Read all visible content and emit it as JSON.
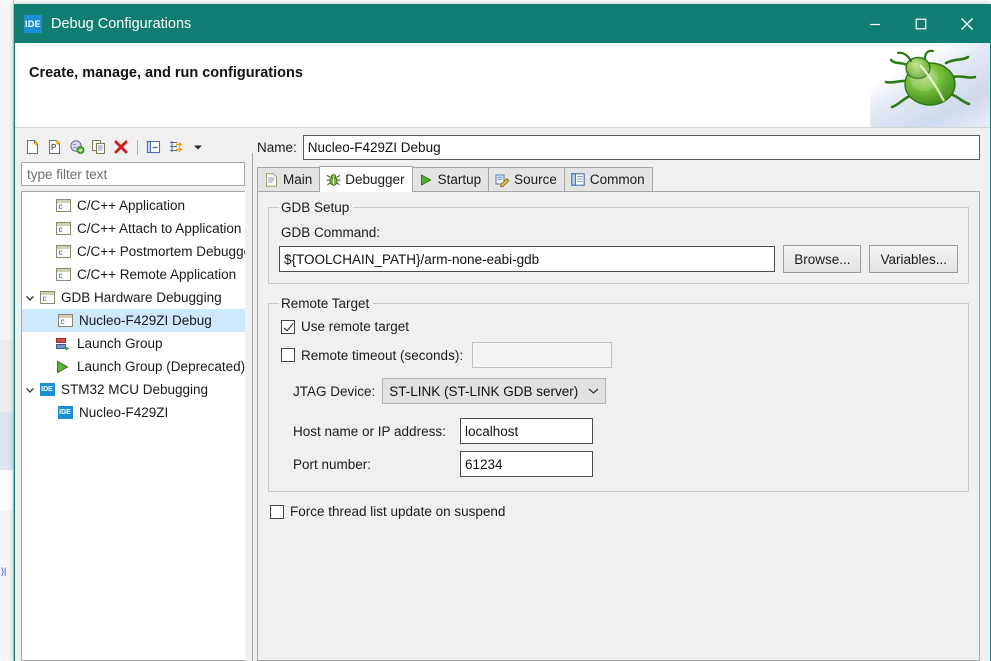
{
  "window": {
    "title": "Debug Configurations",
    "app_icon_text": "IDE",
    "minimize_label": "Minimize",
    "maximize_label": "Maximize",
    "close_label": "Close",
    "titlebar_color": "#117c71"
  },
  "banner": {
    "heading": "Create, manage, and run configurations",
    "art_icon": "green-bug"
  },
  "left_panel": {
    "toolbar": [
      {
        "name": "new-launch-configuration-icon",
        "label": "New launch configuration"
      },
      {
        "name": "new-prototype-icon",
        "label": "New prototype"
      },
      {
        "name": "export-launch-configuration-icon",
        "label": "Export"
      },
      {
        "name": "duplicate-icon",
        "label": "Duplicate"
      },
      {
        "name": "delete-icon",
        "label": "Delete"
      },
      {
        "name": "collapse-all-icon",
        "label": "Collapse All"
      },
      {
        "name": "filter-launch-configurations-icon",
        "label": "Filter launch configurations"
      },
      {
        "name": "view-menu-chevron-icon",
        "label": "View Menu"
      }
    ],
    "filter_placeholder": "type filter text",
    "filter_value": "",
    "tree": [
      {
        "label": "C/C++ Application",
        "indent": 1,
        "icon": "c-config-icon",
        "twisty": "none",
        "selected": false
      },
      {
        "label": "C/C++ Attach to Application",
        "indent": 1,
        "icon": "c-config-icon",
        "twisty": "none",
        "selected": false
      },
      {
        "label": "C/C++ Postmortem Debugger",
        "indent": 1,
        "icon": "c-config-icon",
        "twisty": "none",
        "selected": false
      },
      {
        "label": "C/C++ Remote Application",
        "indent": 1,
        "icon": "c-config-icon",
        "twisty": "none",
        "selected": false
      },
      {
        "label": "GDB Hardware Debugging",
        "indent": 1,
        "icon": "c-config-icon",
        "twisty": "expanded",
        "selected": false
      },
      {
        "label": "Nucleo-F429ZI Debug",
        "indent": 2,
        "icon": "c-config-icon",
        "twisty": "none",
        "selected": true
      },
      {
        "label": "Launch Group",
        "indent": 1,
        "icon": "launch-group-icon",
        "twisty": "none",
        "selected": false
      },
      {
        "label": "Launch Group (Deprecated)",
        "indent": 1,
        "icon": "launch-group-deprecated-icon",
        "twisty": "none",
        "selected": false
      },
      {
        "label": "STM32 MCU Debugging",
        "indent": 1,
        "icon": "ide-icon",
        "twisty": "expanded",
        "selected": false
      },
      {
        "label": "Nucleo-F429ZI",
        "indent": 2,
        "icon": "ide-icon",
        "twisty": "none",
        "selected": false
      }
    ]
  },
  "right_panel": {
    "name_label": "Name:",
    "name_value": "Nucleo-F429ZI Debug",
    "tabs": [
      {
        "label": "Main",
        "icon": "document-icon",
        "active": false
      },
      {
        "label": "Debugger",
        "icon": "bug-icon",
        "active": true
      },
      {
        "label": "Startup",
        "icon": "play-icon",
        "active": false
      },
      {
        "label": "Source",
        "icon": "source-folder-icon",
        "active": false
      },
      {
        "label": "Common",
        "icon": "common-icon",
        "active": false
      }
    ],
    "gdb_setup": {
      "legend": "GDB Setup",
      "command_label": "GDB Command:",
      "command_value": "${TOOLCHAIN_PATH}/arm-none-eabi-gdb",
      "browse_label": "Browse...",
      "variables_label": "Variables..."
    },
    "remote_target": {
      "legend": "Remote Target",
      "use_remote_target_label": "Use remote target",
      "use_remote_target_checked": true,
      "remote_timeout_label": "Remote timeout (seconds):",
      "remote_timeout_checked": false,
      "remote_timeout_value": "",
      "jtag_device_label": "JTAG Device:",
      "jtag_device_value": "ST-LINK (ST-LINK GDB server)",
      "host_label": "Host name or IP address:",
      "host_value": "localhost",
      "port_label": "Port number:",
      "port_value": "61234"
    },
    "force_thread_label": "Force thread list update on suspend",
    "force_thread_checked": false
  }
}
